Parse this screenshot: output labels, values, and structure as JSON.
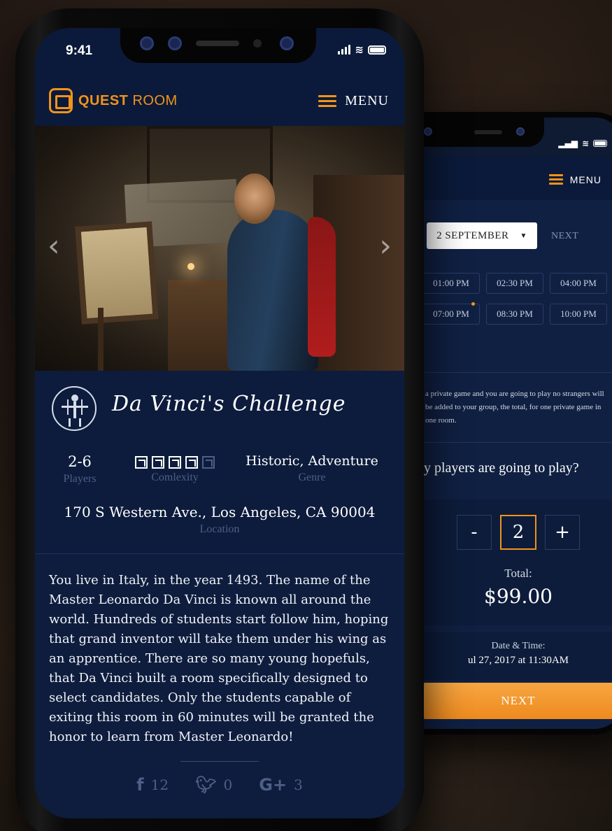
{
  "brand": {
    "name_bold": "QUEST",
    "name_light": " ROOM",
    "accent_color": "#f2931a"
  },
  "status": {
    "time": "9:41"
  },
  "header": {
    "menu_label": "MENU"
  },
  "game": {
    "title": "Da Vinci's Challenge",
    "players_value": "2-6",
    "players_label": "Players",
    "complexity_level": 4,
    "complexity_max": 5,
    "complexity_label": "Comlexity",
    "genre_value": "Historic, Adventure",
    "genre_label": "Genre",
    "address": "170 S Western Ave., Los Angeles, CA 90004",
    "address_label": "Location",
    "description": "You live in Italy, in the year 1493. The name of the Master Leonardo Da Vinci is known all around the world. Hundreds of students start follow him, hoping that grand inventor will take them under his wing as an apprentice. There are so many young hopefuls, that Da Vinci built a room specifically designed to select candidates. Only the students capable of exiting this room in 60 minutes will be granted the honor to learn from Master Leonardo!"
  },
  "social": {
    "facebook_icon": "facebook-icon",
    "facebook_count": "12",
    "twitter_icon": "twitter-icon",
    "twitter_count": "0",
    "gplus_icon": "google-plus-icon",
    "gplus_label": "G+",
    "gplus_count": "3"
  },
  "booking": {
    "menu_label": "MENU",
    "date": "2 SEPTEMBER",
    "next_link": "NEXT",
    "slots": [
      "01:00 PM",
      "02:30 PM",
      "04:00 PM",
      "07:00 PM",
      "08:30 PM",
      "10:00 PM"
    ],
    "private_text": "a private game and you are going to play no strangers will be added to your group, the total, for one private game in one room.",
    "question": "y players are going to play?",
    "minus": "-",
    "plus": "+",
    "player_count": "2",
    "total_label": "Total:",
    "total_value": "$99.00",
    "datetime_label": "Date & Time:",
    "datetime_value": "ul 27, 2017 at 11:30AM",
    "next_button": "NEXT"
  }
}
